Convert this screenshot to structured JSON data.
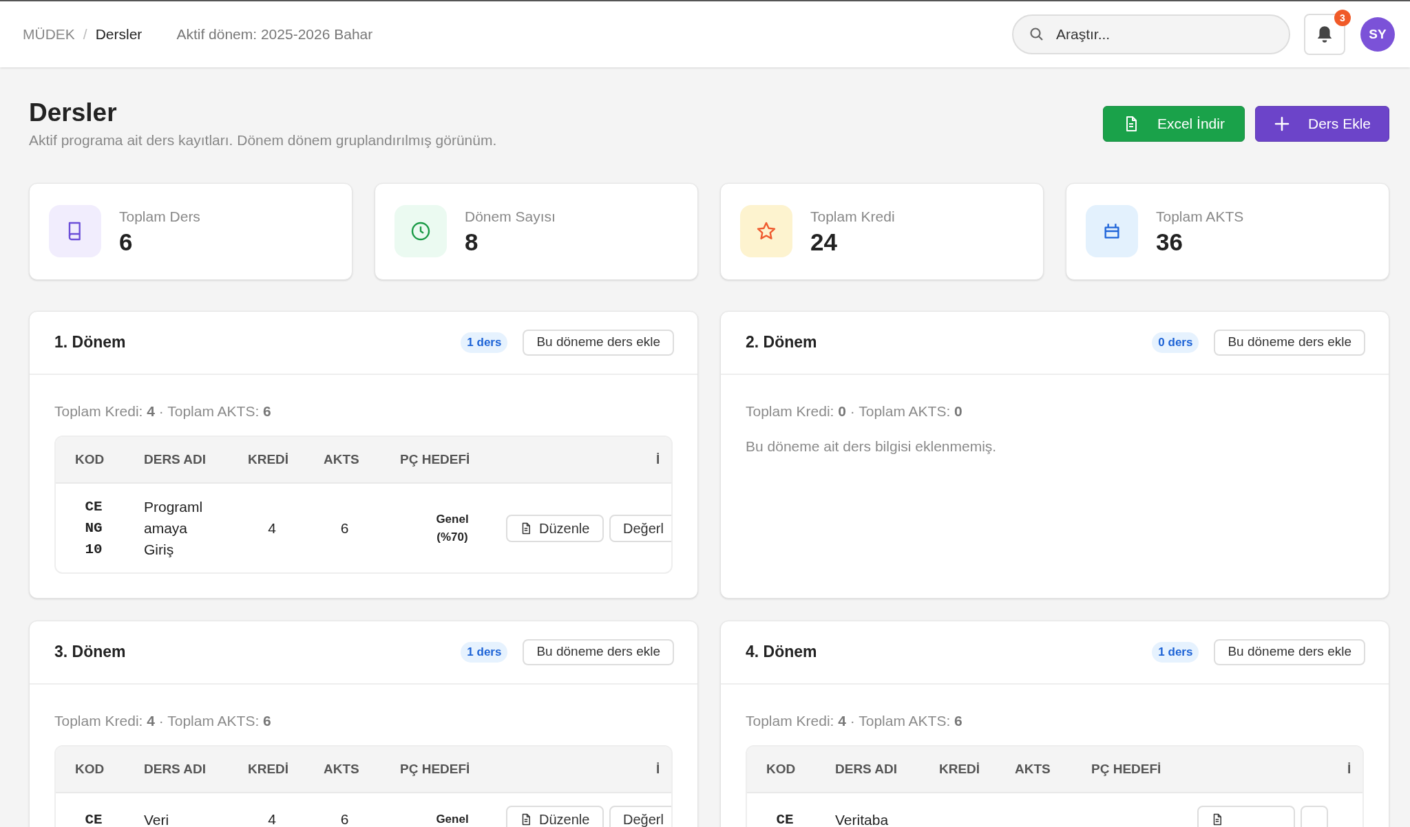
{
  "breadcrumb": [
    {
      "label": "MÜDEK",
      "current": false
    },
    {
      "label": "Dersler",
      "current": true
    }
  ],
  "breadcrumb_separator": "/",
  "active_term": "Aktif dönem: 2025-2026 Bahar",
  "search": {
    "placeholder": "Araştır..."
  },
  "notifications": {
    "count": "3"
  },
  "avatar": "SY",
  "page": {
    "title": "Dersler",
    "subtitle": "Aktif programa ait ders kayıtları. Dönem dönem gruplandırılmış görünüm."
  },
  "actions": [
    {
      "kind": "excel",
      "label": "Excel İndir"
    },
    {
      "kind": "add",
      "label": "Ders Ekle"
    }
  ],
  "stats": [
    {
      "kind": "book",
      "label": "Toplam Ders",
      "value": "6"
    },
    {
      "kind": "clock",
      "label": "Dönem Sayısı",
      "value": "8"
    },
    {
      "kind": "star",
      "label": "Toplam Kredi",
      "value": "24"
    },
    {
      "kind": "calendar",
      "label": "Toplam AKTS",
      "value": "36"
    }
  ],
  "periods": [
    {
      "title": "1. Dönem",
      "count": "1 ders",
      "add_label": "Bu döneme ders ekle",
      "summary": "Toplam Kredi: **4** · Toplam AKTS: **6**",
      "columns": [
        "KOD",
        "DERS ADI",
        "KREDİ",
        "AKTS",
        "PÇ HEDEFİ",
        "İ"
      ],
      "rows": [
        {
          "code": "CENG10",
          "name": "Programlamaya Giriş",
          "credit": "4",
          "ects": "6",
          "target": "Genel (%70)",
          "buttons": [
            {
              "kind": "edit",
              "label": "Düzenle"
            },
            {
              "kind": "plain",
              "label": "Değerl"
            }
          ]
        }
      ]
    },
    {
      "title": "2. Dönem",
      "count": "0 ders",
      "add_label": "Bu döneme ders ekle",
      "summary": "Toplam Kredi: **0** · Toplam AKTS: **0**",
      "empty_text": "Bu döneme ait ders bilgisi eklenmemiş."
    },
    {
      "title": "3. Dönem",
      "count": "1 ders",
      "add_label": "Bu döneme ders ekle",
      "summary": "Toplam Kredi: **4** · Toplam AKTS: **6**",
      "columns": [
        "KOD",
        "DERS ADI",
        "KREDİ",
        "AKTS",
        "PÇ HEDEFİ",
        "İ"
      ],
      "rows": [
        {
          "code": "CE",
          "name": "Veri",
          "credit": "4",
          "ects": "6",
          "target": "Genel",
          "buttons": [
            {
              "kind": "edit",
              "label": "Düzenle"
            },
            {
              "kind": "plain",
              "label": "Değerl"
            }
          ]
        }
      ]
    },
    {
      "title": "4. Dönem",
      "count": "1 ders",
      "add_label": "Bu döneme ders ekle",
      "summary": "Toplam Kredi: **4** · Toplam AKTS: **6**",
      "columns": [
        "KOD",
        "DERS ADI",
        "KREDİ",
        "AKTS",
        "PÇ HEDEFİ",
        "İ"
      ],
      "rows": [
        {
          "code": "CE",
          "name": "Veritaba",
          "buttons": [
            {
              "kind": "edit"
            },
            {
              "kind": "plain"
            }
          ]
        }
      ]
    }
  ]
}
